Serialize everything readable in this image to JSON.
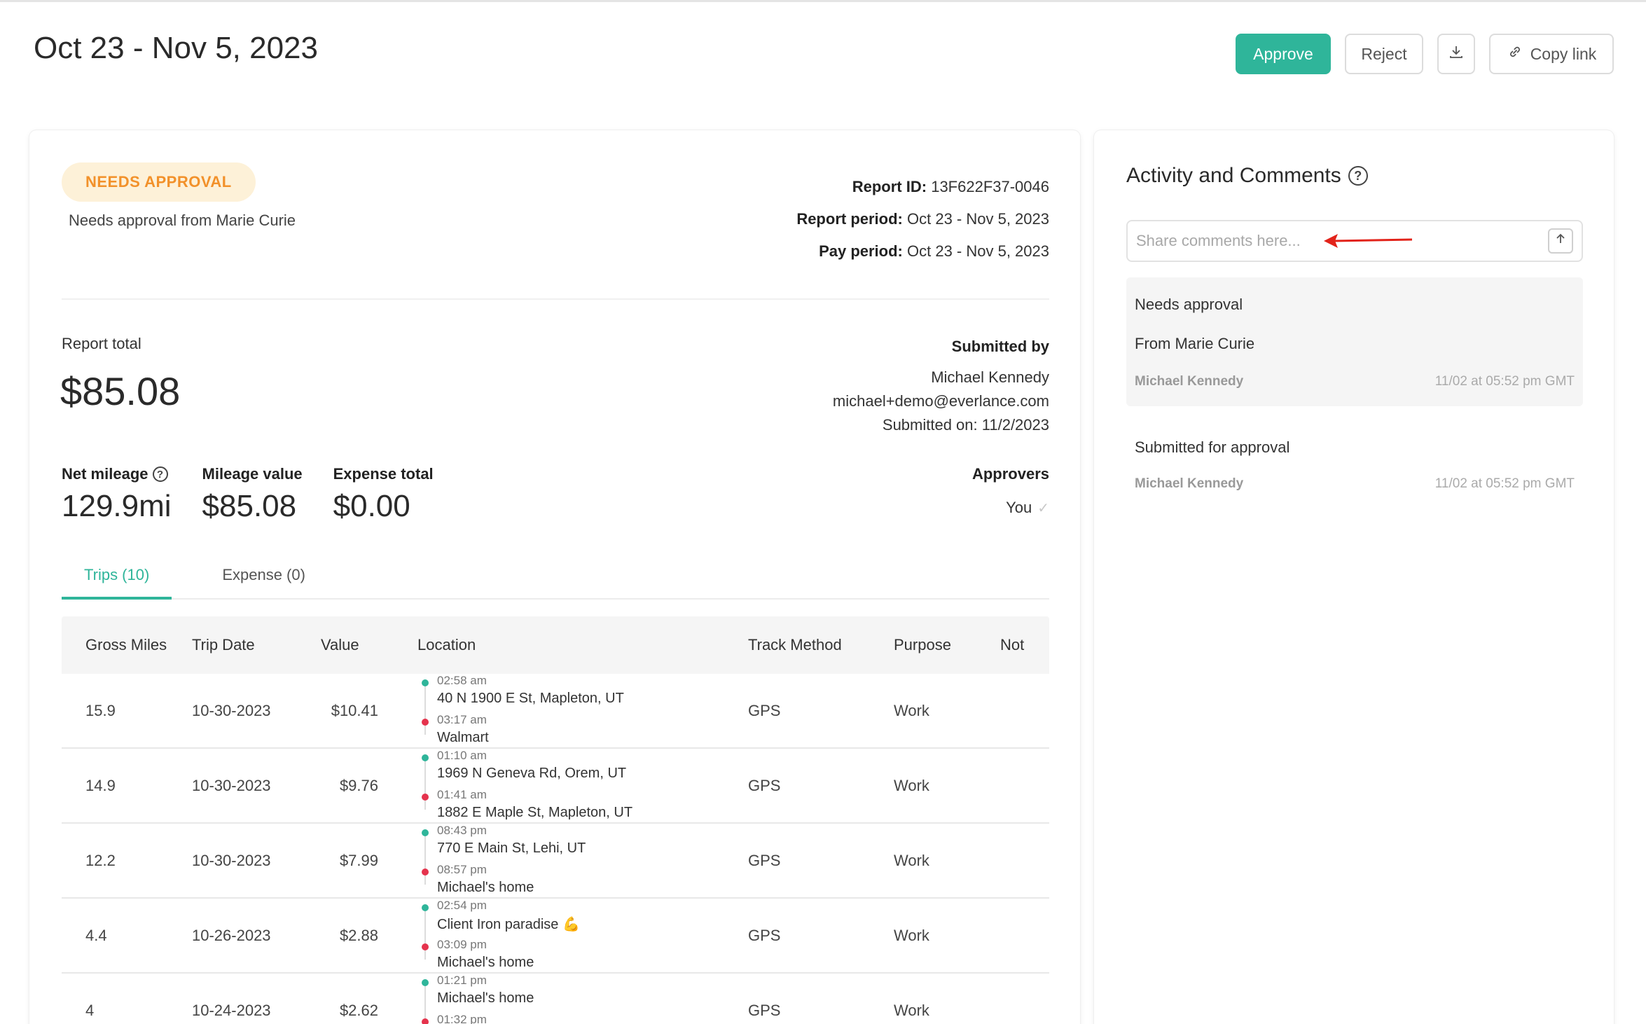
{
  "header": {
    "title": "Oct 23 - Nov 5, 2023",
    "approve_label": "Approve",
    "reject_label": "Reject",
    "copy_link_label": "Copy link"
  },
  "report": {
    "status_badge": "NEEDS APPROVAL",
    "needs_from": "Needs approval from Marie Curie",
    "report_id_label": "Report ID:",
    "report_id": "13F622F37-0046",
    "report_period_label": "Report period:",
    "report_period": "Oct 23 - Nov 5, 2023",
    "pay_period_label": "Pay period:",
    "pay_period": "Oct 23 - Nov 5, 2023",
    "total_label": "Report total",
    "total": "$85.08",
    "submitted_by_label": "Submitted by",
    "submitter_name": "Michael Kennedy",
    "submitter_email": "michael+demo@everlance.com",
    "submitted_on": "Submitted on: 11/2/2023",
    "stats": {
      "net_mileage_label": "Net mileage",
      "net_mileage": "129.9mi",
      "mileage_value_label": "Mileage value",
      "mileage_value": "$85.08",
      "expense_total_label": "Expense total",
      "expense_total": "$0.00"
    },
    "approvers_label": "Approvers",
    "approver": "You"
  },
  "tabs": [
    {
      "label": "Trips (10)",
      "active": true
    },
    {
      "label": "Expense (0)",
      "active": false
    }
  ],
  "table": {
    "headers": [
      "Gross Miles",
      "Trip Date",
      "Value",
      "Location",
      "Track Method",
      "Purpose",
      "Not"
    ],
    "rows": [
      {
        "miles": "15.9",
        "date": "10-30-2023",
        "value": "$10.41",
        "start_time": "02:58 am",
        "start": "40 N 1900 E St, Mapleton, UT",
        "end_time": "03:17 am",
        "end": "Walmart",
        "method": "GPS",
        "purpose": "Work"
      },
      {
        "miles": "14.9",
        "date": "10-30-2023",
        "value": "$9.76",
        "start_time": "01:10 am",
        "start": "1969 N Geneva Rd, Orem, UT",
        "end_time": "01:41 am",
        "end": "1882 E Maple St, Mapleton, UT",
        "method": "GPS",
        "purpose": "Work"
      },
      {
        "miles": "12.2",
        "date": "10-30-2023",
        "value": "$7.99",
        "start_time": "08:43 pm",
        "start": "770 E Main St, Lehi, UT",
        "end_time": "08:57 pm",
        "end": "Michael's home",
        "method": "GPS",
        "purpose": "Work"
      },
      {
        "miles": "4.4",
        "date": "10-26-2023",
        "value": "$2.88",
        "start_time": "02:54 pm",
        "start": "Client Iron paradise 💪",
        "end_time": "03:09 pm",
        "end": "Michael's home",
        "method": "GPS",
        "purpose": "Work"
      },
      {
        "miles": "4",
        "date": "10-24-2023",
        "value": "$2.62",
        "start_time": "01:21 pm",
        "start": "Michael's home",
        "end_time": "01:32 pm",
        "end": "",
        "method": "GPS",
        "purpose": "Work"
      }
    ]
  },
  "activity": {
    "title": "Activity and Comments",
    "comment_placeholder": "Share comments here...",
    "items": [
      {
        "title": "Needs approval",
        "subtitle": "From Marie Curie",
        "user": "Michael Kennedy",
        "time": "11/02 at 05:52 pm GMT"
      },
      {
        "title": "Submitted for approval",
        "user": "Michael Kennedy",
        "time": "11/02 at 05:52 pm GMT"
      }
    ]
  },
  "colors": {
    "accent": "#2fb59a",
    "badge_bg": "#fdf1d8",
    "badge_text": "#f2912a",
    "end_dot": "#e5334d",
    "annotation_arrow": "#e2231a"
  }
}
